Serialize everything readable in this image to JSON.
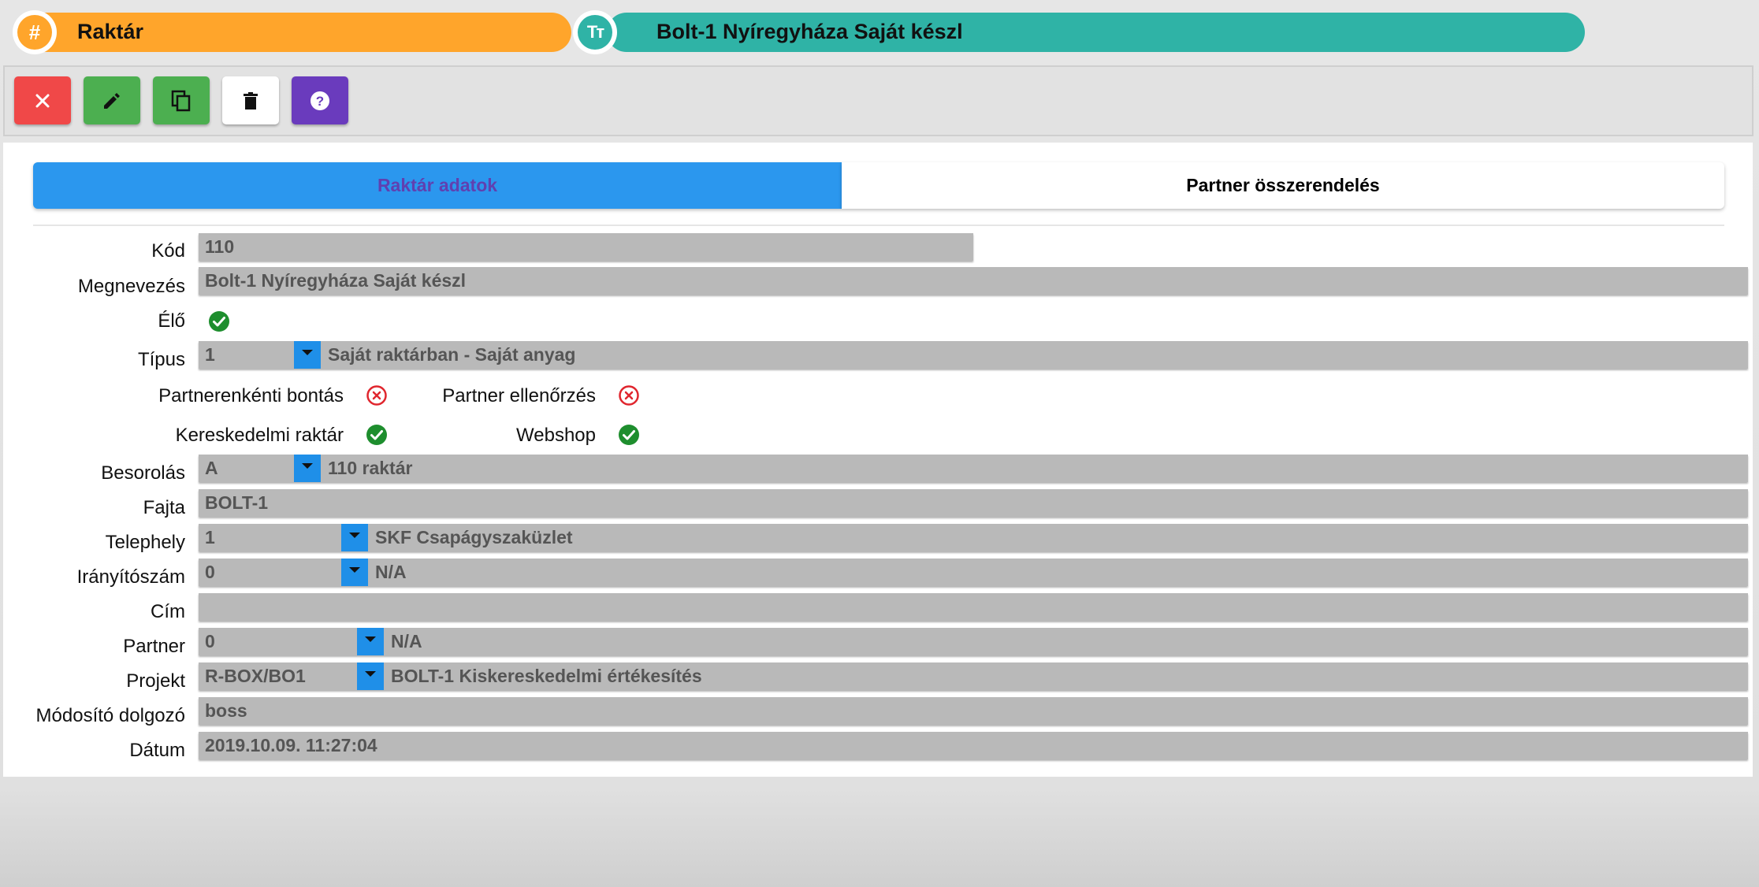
{
  "header": {
    "warehouse_title": "Raktár",
    "record_name": "Bolt-1 Nyíregyháza Saját készl",
    "warehouse_badge_icon": "hash-icon",
    "record_badge_icon": "text-type-icon",
    "warehouse_color": "#ffa52b",
    "record_color": "#2fb3a6"
  },
  "toolbar": {
    "buttons": [
      {
        "name": "close",
        "icon": "close-icon",
        "color": "#f04848"
      },
      {
        "name": "edit",
        "icon": "pencil-icon",
        "color": "#4caf50"
      },
      {
        "name": "copy",
        "icon": "copy-icon",
        "color": "#4caf50"
      },
      {
        "name": "delete",
        "icon": "trash-icon",
        "color": "#ffffff"
      },
      {
        "name": "help",
        "icon": "help-icon",
        "color": "#6a3bbd"
      }
    ]
  },
  "tabs": {
    "active": "Raktár adatok",
    "inactive": "Partner összerendelés",
    "active_color": "#2b97ee"
  },
  "form": {
    "kod": {
      "label": "Kód",
      "value": "110"
    },
    "megnevezes": {
      "label": "Megnevezés",
      "value": "Bolt-1 Nyíregyháza Saját készl"
    },
    "elo": {
      "label": "Élő",
      "checked": true
    },
    "tipus": {
      "label": "Típus",
      "code": "1",
      "description": "Saját raktárban - Saját anyag"
    },
    "partnerenkenti_bontas": {
      "label": "Partnerenkénti bontás",
      "checked": false
    },
    "partner_ellenorzes": {
      "label": "Partner ellenőrzés",
      "checked": false
    },
    "kereskedelmi_raktar": {
      "label": "Kereskedelmi raktár",
      "checked": true
    },
    "webshop": {
      "label": "Webshop",
      "checked": true
    },
    "besorolas": {
      "label": "Besorolás",
      "code": "A",
      "description": "110 raktár"
    },
    "fajta": {
      "label": "Fajta",
      "value": "BOLT-1"
    },
    "telephely": {
      "label": "Telephely",
      "code": "1",
      "description": "SKF Csapágyszaküzlet"
    },
    "iranyitoszam": {
      "label": "Irányítószám",
      "code": "0",
      "description": "N/A"
    },
    "cim": {
      "label": "Cím",
      "value": ""
    },
    "partner": {
      "label": "Partner",
      "code": "0",
      "description": "N/A"
    },
    "projekt": {
      "label": "Projekt",
      "code": "R-BOX/BO1",
      "description": "BOLT-1 Kiskereskedelmi értékesítés"
    },
    "modosito_dolgozo": {
      "label": "Módosító dolgozó",
      "value": "boss"
    },
    "datum": {
      "label": "Dátum",
      "value": "2019.10.09. 11:27:04"
    }
  },
  "colors": {
    "check_green": "#1e8e2e",
    "cross_red": "#e0262e",
    "dropdown_blue": "#1f8fe8"
  }
}
